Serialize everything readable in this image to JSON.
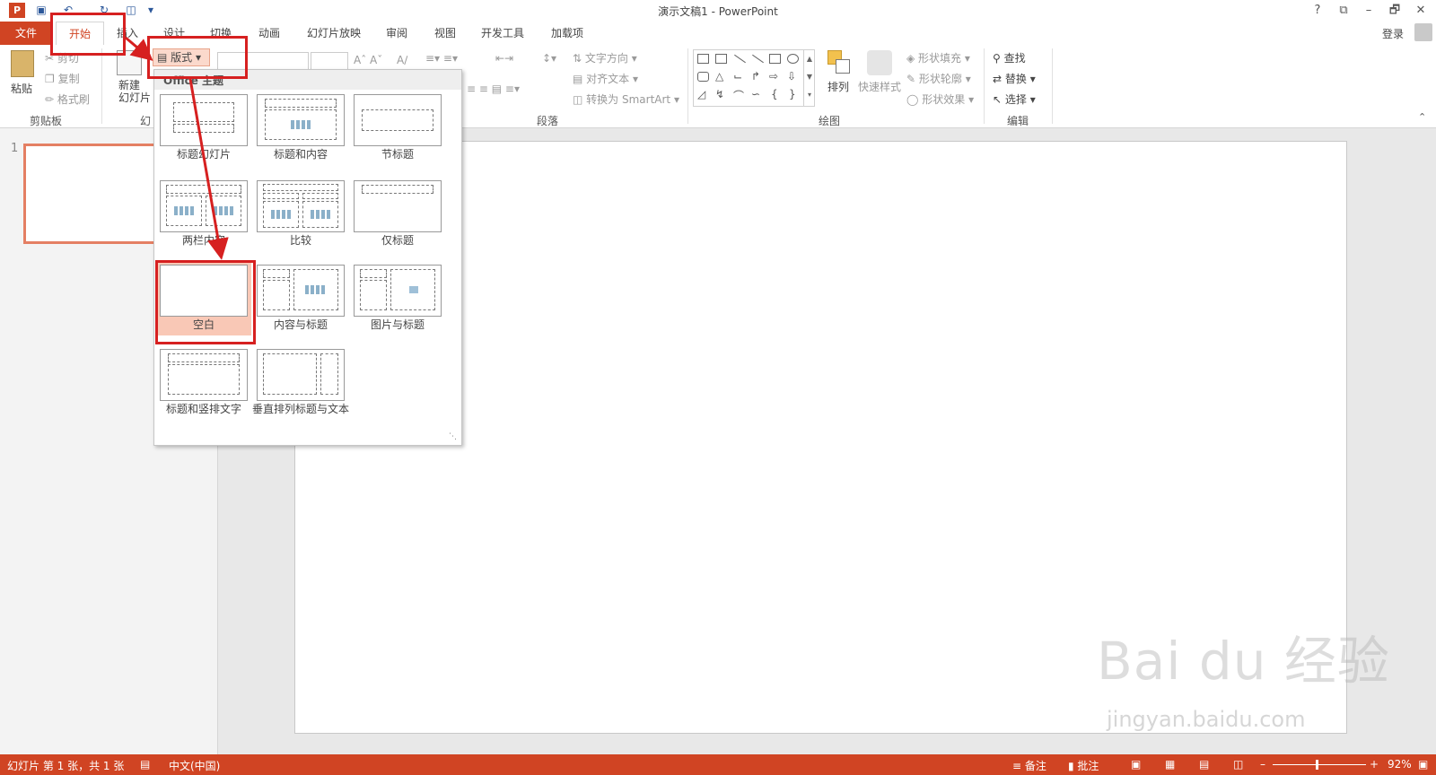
{
  "app": {
    "title": "演示文稿1 - PowerPoint",
    "icon_label": "P"
  },
  "window_controls": [
    "?",
    "⧉",
    "–",
    "🗗",
    "✕"
  ],
  "tabs": [
    {
      "label": "文件"
    },
    {
      "label": "开始"
    },
    {
      "label": "插入"
    },
    {
      "label": "设计"
    },
    {
      "label": "切换"
    },
    {
      "label": "动画"
    },
    {
      "label": "幻灯片放映"
    },
    {
      "label": "审阅"
    },
    {
      "label": "视图"
    },
    {
      "label": "开发工具"
    },
    {
      "label": "加载项"
    }
  ],
  "login": "登录",
  "ribbon": {
    "clipboard": {
      "paste": "粘贴",
      "cut": "剪切",
      "copy": "复制",
      "format_painter": "格式刷",
      "group": "剪贴板"
    },
    "slides": {
      "new_slide_line1": "新建",
      "new_slide_line2": "幻灯片",
      "layout": "版式",
      "group_initial": "幻"
    },
    "paragraph": {
      "text_direction": "文字方向",
      "align_text": "对齐文本",
      "convert_smartart": "转换为 SmartArt",
      "group": "段落"
    },
    "drawing": {
      "arrange": "排列",
      "quick_styles": "快速样式",
      "shape_fill": "形状填充",
      "shape_outline": "形状轮廓",
      "shape_effects": "形状效果",
      "group": "绘图"
    },
    "editing": {
      "find": "查找",
      "replace": "替换",
      "select": "选择",
      "group": "编辑"
    }
  },
  "slide_pane": {
    "slide_number": "1"
  },
  "layout_gallery": {
    "header": "Office 主题",
    "items": [
      {
        "label": "标题幻灯片"
      },
      {
        "label": "标题和内容"
      },
      {
        "label": "节标题"
      },
      {
        "label": "两栏内容"
      },
      {
        "label": "比较"
      },
      {
        "label": "仅标题"
      },
      {
        "label": "空白"
      },
      {
        "label": "内容与标题"
      },
      {
        "label": "图片与标题"
      },
      {
        "label": "标题和竖排文字"
      },
      {
        "label": "垂直排列标题与文本"
      }
    ]
  },
  "status": {
    "slide_info": "幻灯片 第 1 张，共 1 张",
    "language": "中文(中国)",
    "notes": "备注",
    "comments": "批注",
    "zoom": "92%"
  },
  "watermark": {
    "main": "Bai du 经验",
    "url": "jingyan.baidu.com"
  },
  "colors": {
    "accent": "#d04423",
    "annotation": "#d62020",
    "selected_layout": "#f9c8b6"
  }
}
